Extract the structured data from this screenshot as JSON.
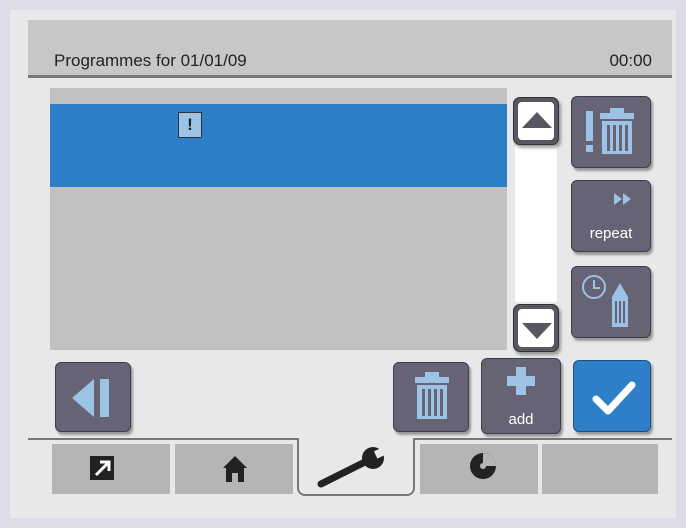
{
  "header": {
    "title": "Programmes for 01/01/09",
    "time": "00:00"
  },
  "list": {
    "rows": [
      {
        "selected": true,
        "flag": "!"
      }
    ]
  },
  "scroll": {
    "up_icon": "triangle-up-icon",
    "down_icon": "triangle-down-icon"
  },
  "side_buttons": {
    "delete_all_icon": "exclamation-trash-icon",
    "repeat_label": "repeat",
    "repeat_icon": "fast-forward-icon",
    "edit_time_icon": "clock-pencil-icon"
  },
  "bottom_buttons": {
    "back_icon": "back-icon",
    "delete_icon": "trash-icon",
    "add_label": "add",
    "add_icon": "plus-icon",
    "confirm_icon": "checkmark-icon"
  },
  "tabs": [
    {
      "name": "external-link",
      "icon": "arrow-out-icon",
      "active": false
    },
    {
      "name": "home",
      "icon": "home-icon",
      "active": false
    },
    {
      "name": "settings",
      "icon": "wrench-icon",
      "active": true
    },
    {
      "name": "disc",
      "icon": "disc-icon",
      "active": false
    },
    {
      "name": "empty",
      "icon": "",
      "active": false
    }
  ],
  "colors": {
    "accent": "#2e7fc7",
    "button": "#656374",
    "icon_blue": "#9cc2e5"
  }
}
